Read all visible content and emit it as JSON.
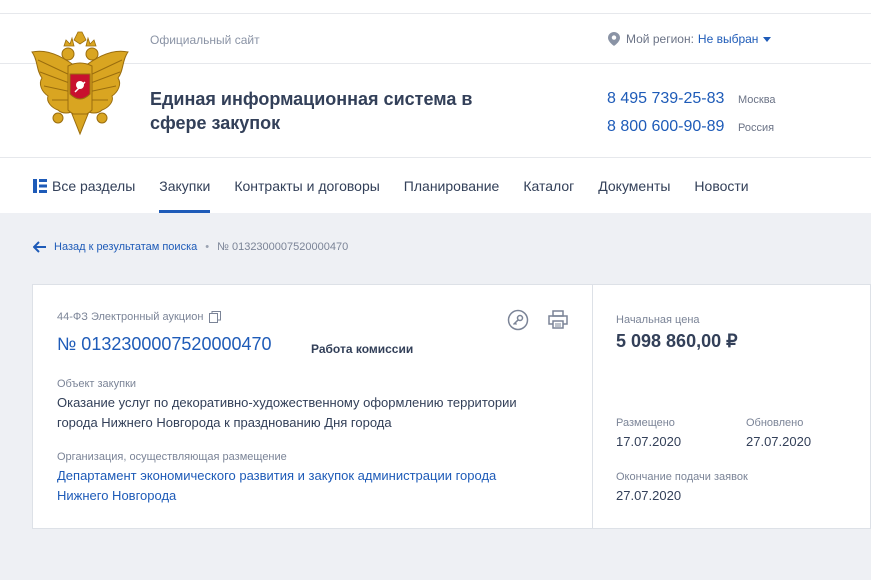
{
  "header": {
    "official_label": "Официальный сайт",
    "site_title": "Единая информационная система в сфере закупок",
    "region": {
      "label": "Мой регион:",
      "value": "Не выбран"
    },
    "phones": [
      {
        "number": "8 495 739-25-83",
        "caption": "Москва"
      },
      {
        "number": "8 800 600-90-89",
        "caption": "Россия"
      }
    ]
  },
  "nav": {
    "items": [
      {
        "label": "Все разделы"
      },
      {
        "label": "Закупки"
      },
      {
        "label": "Контракты и договоры"
      },
      {
        "label": "Планирование"
      },
      {
        "label": "Каталог"
      },
      {
        "label": "Документы"
      },
      {
        "label": "Новости"
      }
    ],
    "active": "Закупки"
  },
  "breadcrumb": {
    "back_label": "Назад к результатам поиска",
    "separator": "•",
    "current": "№ 0132300007520000470"
  },
  "purchase": {
    "law_type": "44-ФЗ Электронный аукцион",
    "number": "№ 0132300007520000470",
    "status": "Работа комиссии",
    "object_label": "Объект закупки",
    "object_text": "Оказание услуг по декоративно-художественному оформлению территории города Нижнего Новгорода к празднованию Дня города",
    "org_label": "Организация, осуществляющая размещение",
    "org_name": "Департамент экономического развития и закупок администрации города Нижнего Новгорода"
  },
  "summary": {
    "price_label": "Начальная цена",
    "price": "5 098 860,00 ₽",
    "posted_label": "Размещено",
    "posted": "17.07.2020",
    "updated_label": "Обновлено",
    "updated": "27.07.2020",
    "deadline_label": "Окончание подачи заявок",
    "deadline": "27.07.2020"
  },
  "colors": {
    "accent": "#1e5bb8",
    "text": "#334059",
    "muted": "#7b8497",
    "background": "#eef0f4"
  },
  "icons": [
    "coat-of-arms",
    "location-pin-icon",
    "caret-down-icon",
    "grid-menu-icon",
    "arrow-left-icon",
    "copy-icon",
    "key-icon",
    "printer-icon"
  ]
}
